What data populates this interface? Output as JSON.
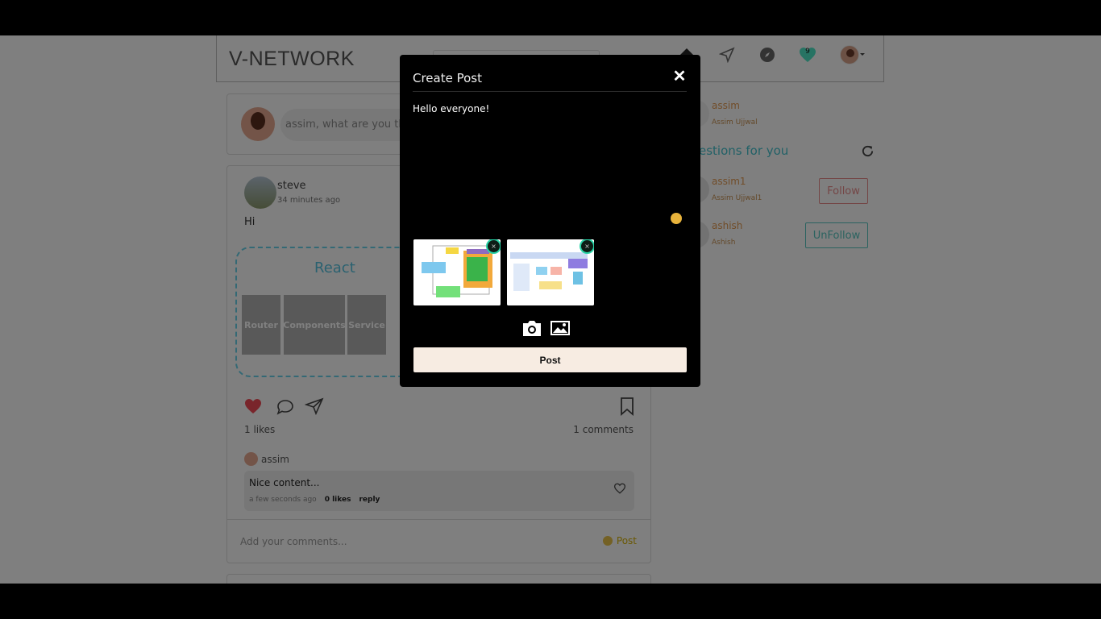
{
  "header": {
    "logo": "V-NETWORK",
    "notification_count": "9"
  },
  "status": {
    "prompt": "assim, what are you think"
  },
  "post": {
    "author": "steve",
    "time": "34 minutes ago",
    "text": "Hi",
    "image": {
      "title": "React",
      "boxes": [
        "Router",
        "Components",
        "Service"
      ]
    },
    "likes": "1 likes",
    "comments_count": "1 comments",
    "comment": {
      "user": "assim",
      "text": "Nice content...",
      "time": "a few seconds ago",
      "likes": "0 likes",
      "reply": "reply"
    },
    "add_comment_placeholder": "Add your comments...",
    "post_label": "Post"
  },
  "sidebar": {
    "me": {
      "name": "assim",
      "fullname": "Assim Ujjwal"
    },
    "suggestions_title": "estions for you",
    "suggestions": [
      {
        "name": "assim1",
        "fullname": "Assim Ujjwal1",
        "action": "Follow"
      },
      {
        "name": "ashish",
        "fullname": "Ashish",
        "action": "UnFollow"
      }
    ]
  },
  "modal": {
    "title": "Create Post",
    "close": "✕",
    "content": "Hello everyone!",
    "remove_image": "×",
    "post_button": "Post"
  }
}
